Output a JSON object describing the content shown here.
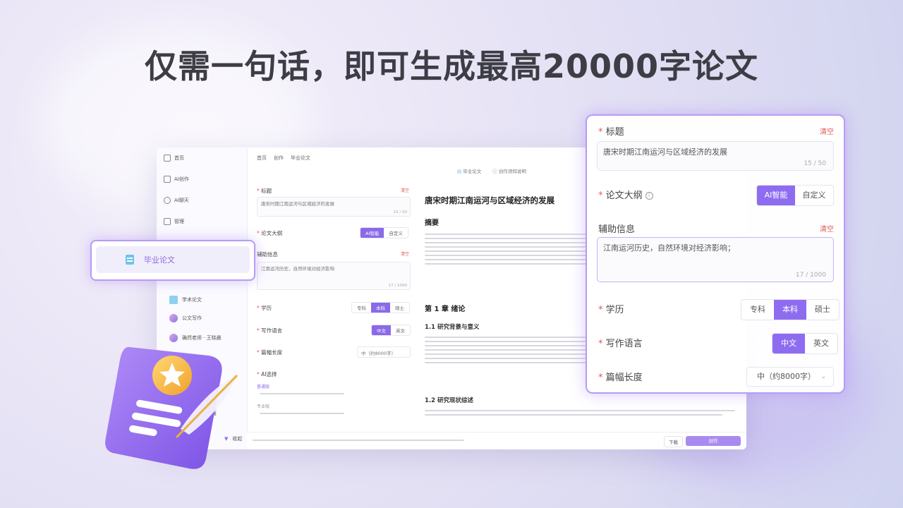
{
  "headline": "仅需一句话，即可生成最高20000字论文",
  "colors": {
    "accent": "#8e6cf0",
    "accent_light": "#b69bf5",
    "danger": "#e25a5a",
    "chip_icon": "#6ec3e8"
  },
  "sidebar": {
    "items": [
      {
        "label": "首页",
        "icon": "home-icon"
      },
      {
        "label": "AI创作",
        "icon": "edit-icon"
      },
      {
        "label": "AI聊天",
        "icon": "chat-icon"
      },
      {
        "label": "管理",
        "icon": "manage-icon"
      }
    ],
    "sub_items": [
      {
        "label": "学术论文"
      },
      {
        "label": "公文写作"
      },
      {
        "label": "确然老师 · 王晓晨"
      }
    ],
    "more": "王自唐",
    "collapse": "收起"
  },
  "breadcrumb": [
    "首页",
    "创作",
    "毕业论文"
  ],
  "small_form": {
    "title_label": "标题",
    "title_value": "唐宋时期江南运河与区域经济的发展",
    "title_count": "15 / 50",
    "clear": "清空",
    "outline_label": "论文大纲",
    "outline_options": [
      "AI智能",
      "自定义"
    ],
    "assist_label": "辅助信息",
    "assist_value": "江南运河历史，自然环境对经济影响",
    "assist_count": "17 / 1000",
    "degree_label": "学历",
    "degree_options": [
      "专科",
      "本科",
      "硕士"
    ],
    "language_label": "写作语言",
    "language_options": [
      "中文",
      "英文"
    ],
    "length_label": "篇幅长度",
    "length_value": "中（约8000字）",
    "ai_label": "AI选择",
    "ai_options": [
      "普通版",
      "专业版"
    ]
  },
  "chip": {
    "label": "毕业论文",
    "icon": "document-icon"
  },
  "doc": {
    "tabs": [
      "毕业论文",
      "创作须知说明"
    ],
    "title": "唐宋时期江南运河与区域经济的发展",
    "abstract_heading": "摘要",
    "chapter1": "第 1 章 绪论",
    "section1_1": "1.1 研究背景与意义",
    "section1_2": "1.2 研究现状综述",
    "download": "下载",
    "generate": "创作"
  },
  "panel": {
    "title_label": "标题",
    "clear": "清空",
    "title_value": "唐宋时期江南运河与区域经济的发展",
    "title_count": "15 / 50",
    "outline_label": "论文大纲",
    "outline_options": [
      "AI智能",
      "自定义"
    ],
    "assist_label": "辅助信息",
    "assist_clear": "清空",
    "assist_value": "江南运河历史，自然环境对经济影响；",
    "assist_count": "17 / 1000",
    "degree_label": "学历",
    "degree_options": [
      "专科",
      "本科",
      "硕士"
    ],
    "language_label": "写作语言",
    "language_options": [
      "中文",
      "英文"
    ],
    "length_label": "篇幅长度",
    "length_value": "中（约8000字）"
  }
}
